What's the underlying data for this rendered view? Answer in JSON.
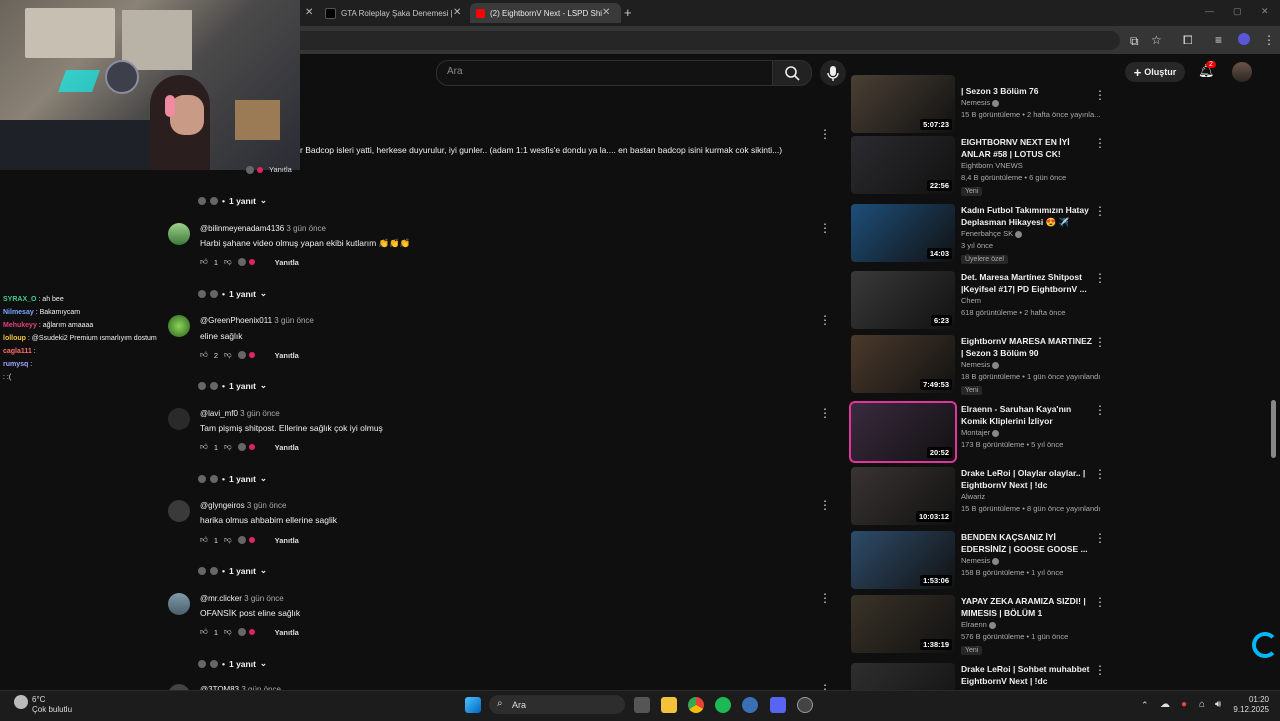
{
  "browser": {
    "tabs": [
      {
        "title": "GTA Roleplay Şaka Denemesi |"
      },
      {
        "title": "(2) EightbornV Next - LSPD Shi"
      }
    ],
    "new_tab": "+"
  },
  "youtube": {
    "search_placeholder": "Ara",
    "create_label": "Oluştur",
    "notif_count": "2"
  },
  "chat": [
    {
      "user": "SYRAX_O",
      "msg": ": ah bee",
      "color": "#3ecf8e"
    },
    {
      "user": "Nilmesay",
      "msg": ": Bakamıycam",
      "color": "#7aa7ff"
    },
    {
      "user": "Mehukeyy",
      "msg": ": ağlarım amaaaa",
      "color": "#e0407a"
    },
    {
      "user": "lolloup",
      "msg": ": @Ssudeki2 Premium ısmarlıyım dostum",
      "color": "#f5c542"
    },
    {
      "user": "cagla111",
      "msg": ":",
      "color": "#ff6b6b"
    },
    {
      "user": "rumysq",
      "msg": ":",
      "color": "#9aa7ff"
    },
    {
      "user": "",
      "msg": ": :(",
      "color": "#ffffff"
    }
  ],
  "comments": {
    "top_text": "r Badcop isleri yatti, herkese duyurulur, iyi gunler.. (adam 1:1 wesfis'e dondu ya la.... en bastan badcop isini kurmak cok sikinti...)",
    "top_reply_label": "Yanıtla",
    "top_replies": "1 yanıt",
    "items": [
      {
        "user": "@bilinmeyenadam4136",
        "time": "3 gün önce",
        "text": "Harbi şahane video olmuş yapan ekibi kutlarım 👏👏👏",
        "likes": "1",
        "reply_label": "Yanıtla",
        "replies": "1 yanıt"
      },
      {
        "user": "@GreenPhoenix011",
        "time": "3 gün önce",
        "text": "eline sağlık",
        "likes": "2",
        "reply_label": "Yanıtla",
        "replies": "1 yanıt"
      },
      {
        "user": "@lavi_mf0",
        "time": "3 gün önce",
        "text": "Tam pişmiş shitpost. Ellerine sağlık çok iyi olmuş",
        "likes": "1",
        "reply_label": "Yanıtla",
        "replies": "1 yanıt"
      },
      {
        "user": "@glyngeiros",
        "time": "3 gün önce",
        "text": "harika olmus ahbabim ellerine saglik",
        "likes": "1",
        "reply_label": "Yanıtla",
        "replies": "1 yanıt"
      },
      {
        "user": "@mr.clicker",
        "time": "3 gün önce",
        "text": "OFANSİK post eline sağlık",
        "likes": "1",
        "reply_label": "Yanıtla",
        "replies": "1 yanıt"
      }
    ],
    "partial_user": "@3TOM83",
    "partial_time": "3 gün önce"
  },
  "sidebar": [
    {
      "title": "| Sezon 3 Bölüm 76",
      "channel": "Nemesis",
      "meta": "15 B görüntüleme • 2 hafta önce yayınla...",
      "duration": "5:07:23",
      "badge": "",
      "thumb": "#4a4034"
    },
    {
      "title": "EIGHTBORNV NEXT EN İYİ ANLAR #58 | LOTUS CK!",
      "channel": "Eightborn VNEWS",
      "meta": "8,4 B görüntüleme • 6 gün önce",
      "duration": "22:56",
      "badge": "Yeni",
      "thumb": "#2c2c30"
    },
    {
      "title": "Kadın Futbol Takımımızın Hatay Deplasman Hikayesi 😍 ✈️",
      "channel": "Fenerbahçe SK",
      "meta": "3 yıl önce",
      "duration": "14:03",
      "badge": "Üyelere özel",
      "thumb": "#1d4f7a"
    },
    {
      "title": "Det. Maresa Martínez Shitpost |Keyifsel #17| PD EightbornV ...",
      "channel": "Chem",
      "meta": "618 görüntüleme • 2 hafta önce",
      "duration": "6:23",
      "badge": "",
      "thumb": "#3a3a3a"
    },
    {
      "title": "EightbornV MARESA MARTINEZ | Sezon 3 Bölüm 90",
      "channel": "Nemesis",
      "meta": "18 B görüntüleme • 1 gün önce yayınlandı",
      "duration": "7:49:53",
      "badge": "Yeni",
      "thumb": "#4b3a2c"
    },
    {
      "title": "Elraenn - Saruhan Kaya'nın Komik Kliplerini İzliyor",
      "channel": "Montajer",
      "meta": "173 B görüntüleme • 5 yıl önce",
      "duration": "20:52",
      "badge": "",
      "thumb": "#3b2a3f"
    },
    {
      "title": "Drake LeRoi | Olaylar olaylar.. | EightbornV Next | !dc",
      "channel": "Alwariz",
      "meta": "15 B görüntüleme • 8 gün önce yayınlandı",
      "duration": "10:03:12",
      "badge": "",
      "thumb": "#3a3432"
    },
    {
      "title": "BENDEN KAÇSANIZ İYİ EDERSİNİZ | GOOSE GOOSE ...",
      "channel": "Nemesis",
      "meta": "158 B görüntüleme • 1 yıl önce",
      "duration": "1:53:06",
      "badge": "",
      "thumb": "#2e4c6a"
    },
    {
      "title": "YAPAY ZEKA ARAMIZA SIZDI! | MIMESIS | BÖLÜM 1",
      "channel": "Elraenn",
      "meta": "576 B görüntüleme • 1 gün önce",
      "duration": "1:38:19",
      "badge": "Yeni",
      "thumb": "#3a3328"
    },
    {
      "title": "Drake LeRoi | Sohbet muhabbet EightbornV Next | !dc",
      "channel": "",
      "meta": "",
      "duration": "",
      "badge": "",
      "thumb": "#2f2f2f"
    }
  ],
  "taskbar": {
    "temp": "6°C",
    "weather": "Çok bulutlu",
    "search": "Ara",
    "time": "01:20",
    "date": "9.12.2025"
  }
}
